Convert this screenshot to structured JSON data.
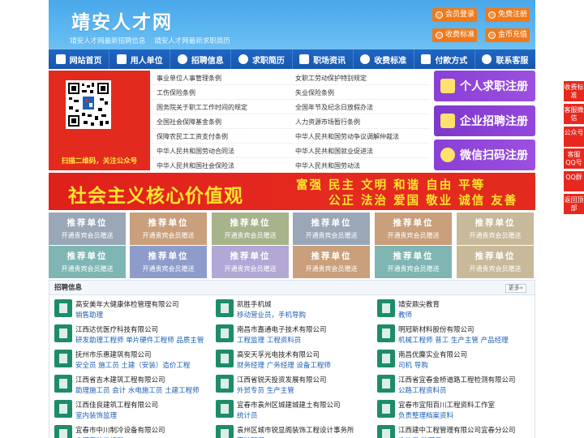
{
  "header": {
    "title": "靖安人才网",
    "sub1": "靖安人才网最新招聘信息",
    "sub2": "靖安人才网最新求职简历",
    "buttons": [
      "会员登录",
      "免费注册",
      "收费标准",
      "金币充值"
    ]
  },
  "nav": [
    "网站首页",
    "用人单位",
    "招聘信息",
    "求职简历",
    "职场资讯",
    "收费标准",
    "付款方式",
    "联系客服"
  ],
  "qr": {
    "caption": "扫描二维码，关注公众号"
  },
  "links": {
    "left": [
      "事业单位人事管理条例",
      "工伤保险条例",
      "国务院关于职工工作时间的规定",
      "全国社会保障基金条例",
      "保障农民工工资支付条例",
      "中华人民共和国劳动合同法",
      "中华人民共和国社会保险法"
    ],
    "right": [
      "女职工劳动保护特别规定",
      "失业保险条例",
      "全国年节及纪念日放假办法",
      "人力资源市场暂行条例",
      "中华人民共和国劳动争议调解仲裁法",
      "中华人民共和国就业促进法",
      "中华人民共和国劳动法"
    ]
  },
  "register": [
    "个人求职注册",
    "企业招聘注册",
    "微信扫码注册"
  ],
  "banner": {
    "big": "社会主义核心价值观",
    "line1": "富强 民主 文明 和谐 自由 平等",
    "line2": "公正 法治 爱国 敬业 诚信 友善"
  },
  "recommend": {
    "title": "推荐单位",
    "sub": "开通贵宾会员赠送"
  },
  "recommend_colors": [
    "#9aa7b6",
    "#c99f7c",
    "#a7b38a",
    "#9aa7b6",
    "#c99f7c",
    "#c7b99a",
    "#7fb6b3",
    "#8e9ccc",
    "#b3a7d6",
    "#c99f7c",
    "#7fb6b3",
    "#c7b99a"
  ],
  "jobs": {
    "heading": "招聘信息",
    "more": "更多»",
    "items": [
      {
        "co": "高安美年大健康体检管理有限公司",
        "pos": "销售助理"
      },
      {
        "co": "凯胜手机城",
        "pos": "移动营业员，手机导购"
      },
      {
        "co": "靖安鼎尖教育",
        "pos": "教师"
      },
      {
        "co": "江西达优医疗科技有限公司",
        "pos": "研发助理工程师 单片硬件工程师 品质主管"
      },
      {
        "co": "南昌市嘉通电子技术有限公司",
        "pos": "工程监理 工程资料员"
      },
      {
        "co": "明冠新材料股份有限公司",
        "pos": "机械工程师 普工 生产主管 产品经理"
      },
      {
        "co": "抚州市乐惠建筑有限公司",
        "pos": "安全员 施工员 土建（安装）造价工程"
      },
      {
        "co": "高安天孚光电技术有限公司",
        "pos": "财务经理 广务经理 设备工程师"
      },
      {
        "co": "南昌优麋实业有限公司",
        "pos": "司机 导购"
      },
      {
        "co": "江西省吉木建筑工程有限公司",
        "pos": "助理施工员 会计 水电施工员 土建工程师"
      },
      {
        "co": "江西省锐天投资发展有限公司",
        "pos": "外贸专员 生产主管"
      },
      {
        "co": "江西省宜春金桥道路工程检测有限公司",
        "pos": "公路工程资料员"
      },
      {
        "co": "江西佳良建筑工程有限公司",
        "pos": "室内装饰监理"
      },
      {
        "co": "宜春市袁州区城建城建土有限公司",
        "pos": "统计员"
      },
      {
        "co": "宜春市宜阳百川工程资料工作室",
        "pos": "负责整理档案资料"
      },
      {
        "co": "宜春市中川制冷设备有限公司",
        "pos": "空调安装维修工"
      },
      {
        "co": "袁州区城市锐显阁装饰工程设计事务所",
        "pos": "家装顾问"
      },
      {
        "co": "江西建中工程管理有限公司宜春分公司",
        "pos": "造价员 监理员"
      }
    ]
  },
  "sidebar": [
    "收费标准",
    "客服微信",
    "公众号",
    "客服QQ号",
    "QQ群",
    "返回顶部"
  ],
  "colors": {
    "nav": "#1757ad",
    "accent": "#e22a1e",
    "header": "#4aa8ea"
  }
}
